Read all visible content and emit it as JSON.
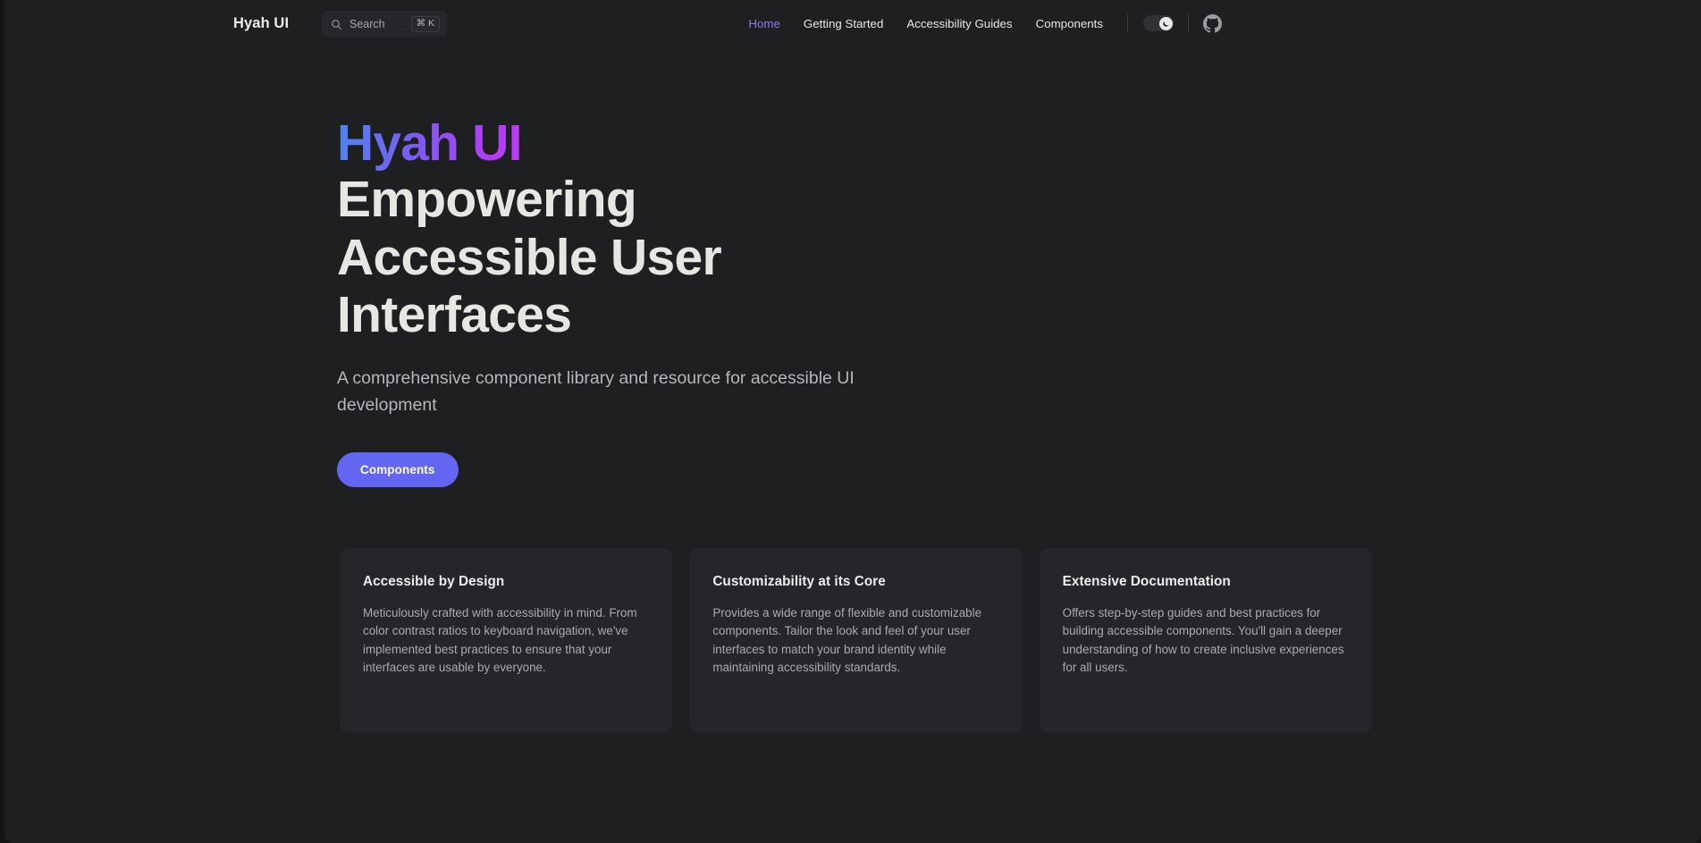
{
  "header": {
    "brand": "Hyah UI",
    "search": {
      "icon": "search-icon",
      "placeholder": "Search",
      "shortcut": "⌘ K"
    },
    "nav_items": [
      {
        "label": "Home",
        "active": true
      },
      {
        "label": "Getting Started",
        "active": false
      },
      {
        "label": "Accessibility Guides",
        "active": false
      },
      {
        "label": "Components",
        "active": false
      }
    ],
    "theme_toggle": {
      "icon": "moon-icon",
      "state": "dark"
    },
    "github": {
      "icon": "github-icon"
    }
  },
  "hero": {
    "gradient_title": "Hyah UI",
    "title": "Empowering Accessible User Interfaces",
    "subtitle": "A comprehensive component library and resource for accessible UI development",
    "cta_label": "Components"
  },
  "cards": [
    {
      "title": "Accessible by Design",
      "body": "Meticulously crafted with accessibility in mind. From color contrast ratios to keyboard navigation, we've implemented best practices to ensure that your interfaces are usable by everyone."
    },
    {
      "title": "Customizability at its Core",
      "body": "Provides a wide range of flexible and customizable components. Tailor the look and feel of your user interfaces to match your brand identity while maintaining accessibility standards."
    },
    {
      "title": "Extensive Documentation",
      "body": "Offers step-by-step guides and best practices for building accessible components. You'll gain a deeper understanding of how to create inclusive experiences for all users."
    }
  ],
  "colors": {
    "page_background": "#1e1f21",
    "card_background": "#252629",
    "accent": "#6366f1",
    "active_nav": "#8a7bf0",
    "gradient_start": "#4e84ef",
    "gradient_end": "#bd3bf5"
  }
}
